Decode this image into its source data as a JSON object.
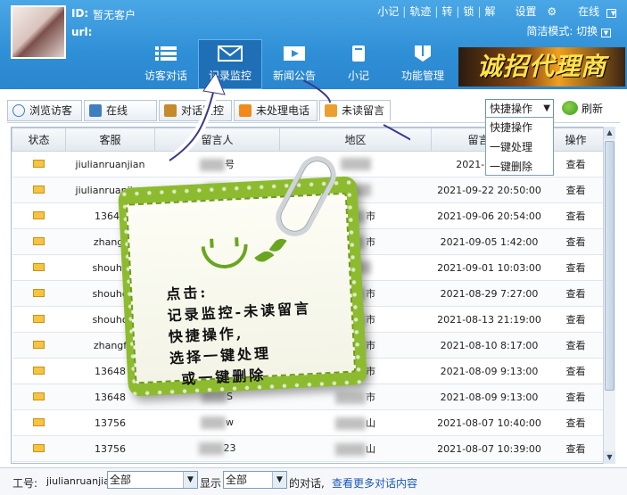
{
  "header": {
    "id_label": "ID:",
    "id_value": "暂无客户",
    "url_label": "url:",
    "toplinks": [
      "小记",
      "轨迹",
      "转",
      "锁",
      "解"
    ],
    "settings": "设置",
    "online": "在线",
    "mode": "简洁模式: 切换"
  },
  "nav": [
    {
      "label": "访客对话"
    },
    {
      "label": "记录监控"
    },
    {
      "label": "新闻公告"
    },
    {
      "label": "小记"
    },
    {
      "label": "功能管理"
    }
  ],
  "banner": "诚招代理商",
  "tabs": [
    "浏览访客",
    "在线",
    "对话监控",
    "未处理电话",
    "未读留言"
  ],
  "quick": {
    "selected": "快捷操作",
    "options": [
      "快捷操作",
      "一键处理",
      "一键删除"
    ]
  },
  "refresh": "刷新",
  "table": {
    "headers": [
      "状态",
      "客服",
      "留言人",
      "地区",
      "留言时间",
      "操作"
    ],
    "rows": [
      {
        "agent": "jiulianruanjian",
        "name": "号",
        "region": "",
        "time": "2021-09-22 2",
        "op": "查看"
      },
      {
        "agent": "jiulianruanjian",
        "name": "",
        "region": "",
        "time": "2021-09-22 20:50:00",
        "op": "查看"
      },
      {
        "agent": "13646",
        "name": "",
        "region": "市",
        "time": "2021-09-06 20:54:00",
        "op": "查看"
      },
      {
        "agent": "zhangf",
        "name": "",
        "region": "市",
        "time": "2021-09-05 1:42:00",
        "op": "查看"
      },
      {
        "agent": "shouho",
        "name": "",
        "region": "",
        "time": "2021-09-01 10:03:00",
        "op": "查看"
      },
      {
        "agent": "shouho",
        "name": "",
        "region": "市",
        "time": "2021-08-29 7:27:00",
        "op": "查看"
      },
      {
        "agent": "shouho",
        "name": "",
        "region": "市",
        "time": "2021-08-13 21:19:00",
        "op": "查看"
      },
      {
        "agent": "zhangf",
        "name": "",
        "region": "市",
        "time": "2021-08-10 8:17:00",
        "op": "查看"
      },
      {
        "agent": "13648",
        "name": "",
        "region": "市",
        "time": "2021-08-09 9:13:00",
        "op": "查看"
      },
      {
        "agent": "13648",
        "name": "S",
        "region": "市",
        "time": "2021-08-09 9:13:00",
        "op": "查看"
      },
      {
        "agent": "13756",
        "name": "w",
        "region": "山",
        "time": "2021-08-07 10:40:00",
        "op": "查看"
      },
      {
        "agent": "13756",
        "name": "23",
        "region": "山",
        "time": "2021-08-07 10:39:00",
        "op": "查看"
      }
    ]
  },
  "bottom": {
    "label": "工号:",
    "value": "jiulianruanjian",
    "sel1": "全部",
    "show": "显示",
    "sel2": "全部",
    "suffix": "的对话,",
    "link": "查看更多对话内容"
  },
  "note": {
    "lines": [
      "点击:",
      "记录监控-未读留言",
      "快捷操作,",
      "选择一键处理",
      "或一键删除"
    ]
  }
}
